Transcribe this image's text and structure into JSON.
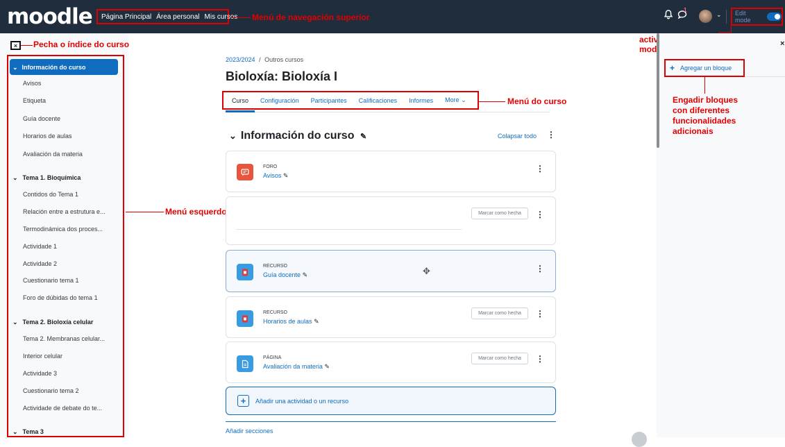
{
  "navbar": {
    "logo_text": "moodle",
    "links": [
      "Página Principal",
      "Área personal",
      "Mis cursos"
    ],
    "notification_badge": "1",
    "edit_mode_label": "Edit mode",
    "edit_mode_on": true,
    "icons": [
      "bell-icon",
      "chat-icon",
      "avatar",
      "chevron-down-icon",
      "toggle-switch"
    ]
  },
  "annotations": {
    "top_nav": "Menú de navegación superior",
    "close_index": "Pecha o índice do curso",
    "left_menu": "Menú esquerdo: índice do curso",
    "course_menu": "Menú do curso",
    "edit_mode_1": "activar/desactivar",
    "edit_mode_2": "modo edición",
    "add_blocks_1": "Engadir bloques",
    "add_blocks_2": "con diferentes",
    "add_blocks_3": "funcionalidades",
    "add_blocks_4": "adicionais"
  },
  "course_index": {
    "close_glyph": "×",
    "sections": [
      {
        "title": "Información do curso",
        "active": true,
        "items": [
          "Avisos",
          "Etiqueta",
          "Guía docente",
          "Horarios de aulas",
          "Avaliación da materia"
        ]
      },
      {
        "title": "Tema 1. Bioquímica",
        "items": [
          "Contidos do Tema 1",
          "Relación entre a estrutura e...",
          "Termodinámica dos proces...",
          "Actividade 1",
          "Actividade 2",
          "Cuestionario tema 1",
          "Foro de dúbidas do tema 1"
        ]
      },
      {
        "title": "Tema 2. Bioloxía celular",
        "items": [
          "Tema 2. Membranas celular...",
          "Interior celular",
          "Actividade 3",
          "Cuestionario tema 2",
          "Actividade de debate do te..."
        ]
      },
      {
        "title": "Tema 3",
        "items": []
      }
    ]
  },
  "main": {
    "breadcrumb": {
      "year": "2023/2024",
      "sep": "/",
      "category": "Outros cursos"
    },
    "title": "Bioloxía: Bioloxía I",
    "tabs": [
      "Curso",
      "Configuración",
      "Participantes",
      "Calificaciones",
      "Informes",
      "More ⌄"
    ],
    "section_title": "Información do curso",
    "collapse_all": "Colapsar todo",
    "activities": [
      {
        "type": "FORO",
        "name": "Avisos",
        "color": "#e8553e",
        "icon": "forum-icon",
        "mark": ""
      },
      {
        "type": "",
        "name": "",
        "color": "",
        "icon": "",
        "mark": "Marcar como hecha"
      },
      {
        "type": "RECURSO",
        "name": "Guía docente",
        "color": "#399be2",
        "icon": "pdf-icon",
        "mark": ""
      },
      {
        "type": "RECURSO",
        "name": "Horarios de aulas",
        "color": "#399be2",
        "icon": "pdf-icon",
        "mark": "Marcar como hecha"
      },
      {
        "type": "PÁGINA",
        "name": "Avaliación da materia",
        "color": "#399be2",
        "icon": "page-icon",
        "mark": "Marcar como hecha"
      }
    ],
    "add_activity": "Añadir una actividad o un recurso",
    "add_sections": "Añadir secciones"
  },
  "drawer": {
    "add_block": "Agregar un bloque",
    "close_glyph": "×"
  },
  "colors": {
    "navbar": "#1f2d3d",
    "primary": "#0f6cbf",
    "annotation": "#e30000"
  }
}
